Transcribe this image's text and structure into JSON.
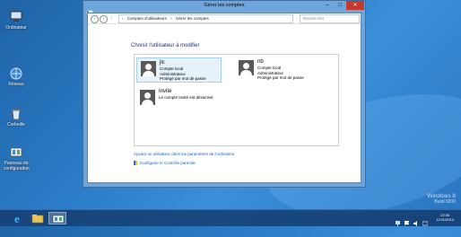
{
  "window": {
    "title": "Gérer les comptes",
    "minimize_symbol": "–",
    "maximize_symbol": "□",
    "close_symbol": "✕"
  },
  "toolbar": {
    "back_symbol": "‹",
    "forward_symbol": "›",
    "up_symbol": "↑",
    "breadcrumb": [
      "Comptes d'utilisateurs",
      "Gérer les comptes"
    ],
    "breadcrumb_separator": "›",
    "search_placeholder": "Rechercher"
  },
  "main": {
    "heading": "Choisir l'utilisateur à modifier",
    "accounts": [
      {
        "name": "jlc",
        "type": "Compte local",
        "role": "Administrateur",
        "status": "Protégé par mot de passe",
        "selected": true
      },
      {
        "name": "nb",
        "type": "Compte local",
        "role": "Administrateur",
        "status": "Protégé par mot de passe",
        "selected": false
      },
      {
        "name": "Invité",
        "type": "Le compte Invité est désactivé",
        "selected": false
      }
    ],
    "add_user_link": "Ajouter un utilisateur dans les paramètres de l'ordinateur",
    "parental_link": "Configurer le Contrôle parental"
  },
  "desktop_icons": [
    {
      "label": "Ordinateur",
      "icon": "computer-icon"
    },
    {
      "label": "Réseau",
      "icon": "network-icon"
    },
    {
      "label": "Corbeille",
      "icon": "recycle-bin-icon"
    },
    {
      "label": "Panneau de configuration",
      "icon": "control-panel-icon"
    }
  ],
  "watermark": {
    "line1": "Windows 8",
    "line2": "Build 9200"
  },
  "clock": {
    "time": "22:06",
    "date": "11/11/2014"
  },
  "colors": {
    "accent": "#1e3287",
    "link": "#1e64b4",
    "close": "#c7392b"
  }
}
